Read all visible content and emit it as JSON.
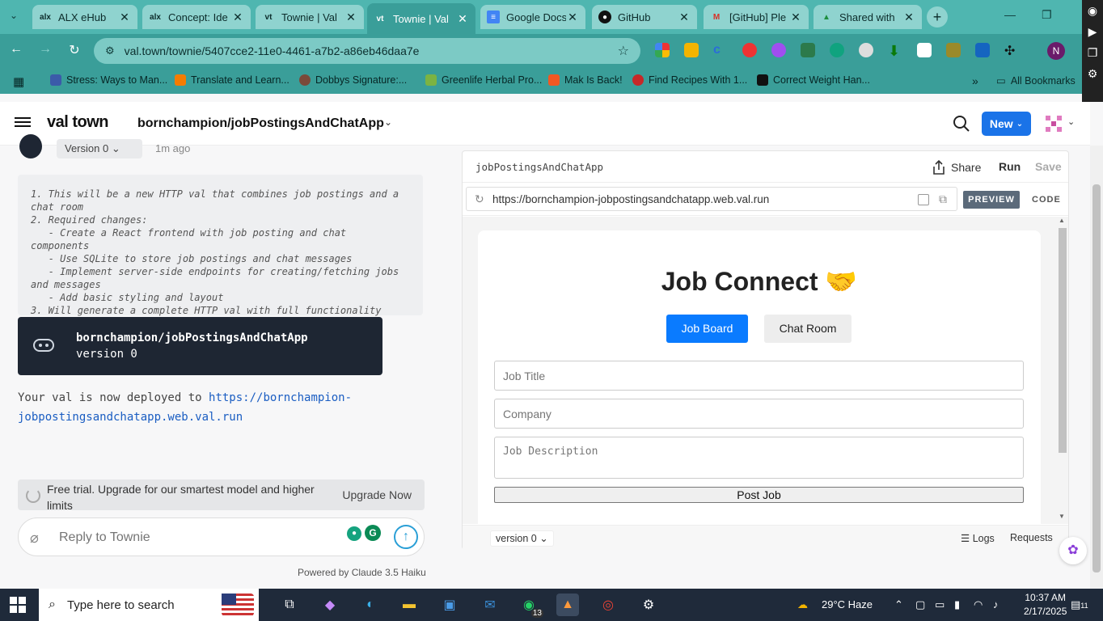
{
  "browser": {
    "tabs": [
      {
        "label": "ALX eHub",
        "favicon": "alx-icon"
      },
      {
        "label": "Concept: Ide",
        "favicon": "alx-icon"
      },
      {
        "label": "Townie | Val",
        "favicon": "valtown-icon"
      },
      {
        "label": "Townie | Val",
        "favicon": "valtown-icon",
        "active": true
      },
      {
        "label": "Google Docs",
        "favicon": "docs-icon"
      },
      {
        "label": "GitHub",
        "favicon": "github-icon"
      },
      {
        "label": "[GitHub] Ple",
        "favicon": "gmail-icon"
      },
      {
        "label": "Shared with",
        "favicon": "drive-icon"
      }
    ],
    "new_tab": "+",
    "url": "val.town/townie/5407cce2-11e0-4461-a7b2-a86eb46daa7e",
    "profile_initial": "N",
    "bookmarks": [
      "Stress: Ways to Man...",
      "Translate and Learn...",
      "Dobbys Signature:...",
      "Greenlife Herbal Pro...",
      "Mak Is Back!",
      "Find Recipes With 1...",
      "Correct Weight Han..."
    ],
    "bookmarks_more": "»",
    "all_bookmarks": "All Bookmarks"
  },
  "app": {
    "logo": "val town",
    "breadcrumb": "bornchampion/jobPostingsAndChatApp",
    "new_button": "New",
    "accent": "#1a73e8"
  },
  "chat": {
    "version_tag": "Version 0",
    "version_time": "1m ago",
    "plan_lines": [
      "1. This will be a new HTTP val that combines job postings and a chat room",
      "2. Required changes:",
      "   - Create a React frontend with job posting and chat components",
      "   - Use SQLite to store job postings and chat messages",
      "   - Implement server-side endpoints for creating/fetching jobs and messages",
      "   - Add basic styling and layout",
      "3. Will generate a complete HTTP val with full functionality"
    ],
    "val_card": {
      "name": "bornchampion/jobPostingsAndChatApp",
      "version": "version 0"
    },
    "deploy_text": "Your val is now deployed to ",
    "deploy_link": "https://bornchampion-jobpostingsandchatapp.web.val.run",
    "trial_text": "Free trial. Upgrade for our smartest model and higher limits",
    "upgrade_label": "Upgrade Now",
    "reply_placeholder": "Reply to Townie",
    "powered_by": "Powered by Claude 3.5 Haiku"
  },
  "preview": {
    "val_name": "jobPostingsAndChatApp",
    "share": "Share",
    "run": "Run",
    "save": "Save",
    "url": "https://bornchampion-jobpostingsandchatapp.web.val.run",
    "preview_tab": "PREVIEW",
    "code_tab": "CODE",
    "page": {
      "title": "Job Connect 🤝",
      "tab_job_board": "Job Board",
      "tab_chat_room": "Chat Room",
      "job_title_placeholder": "Job Title",
      "company_placeholder": "Company",
      "description_placeholder": "Job Description",
      "post_button": "Post Job"
    },
    "footer_version": "version 0 ⌄",
    "logs": "Logs",
    "requests": "Requests"
  },
  "taskbar": {
    "search_placeholder": "Type here to search",
    "whatsapp_badge": "13",
    "weather": "29°C  Haze",
    "time": "10:37 AM",
    "date": "2/17/2025",
    "notifications": "11"
  }
}
